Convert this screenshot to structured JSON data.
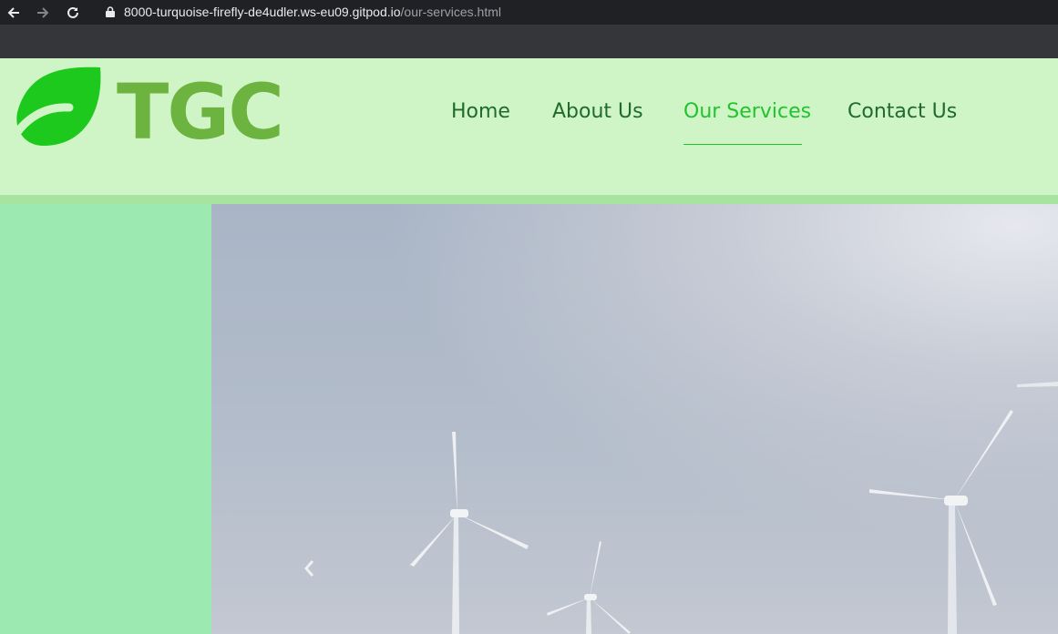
{
  "browser": {
    "url_host": "8000-turquoise-firefly-de4udler.ws-eu09.gitpod.io",
    "url_path": "/our-services.html"
  },
  "header": {
    "logo_text": "TGC",
    "nav": [
      {
        "label": "Home",
        "active": false
      },
      {
        "label": "About Us",
        "active": false
      },
      {
        "label": "Our Services",
        "active": true
      },
      {
        "label": "Contact Us",
        "active": false
      }
    ]
  },
  "colors": {
    "header_bg": "#cff5c6",
    "header_border": "#a8e4a0",
    "side_panel": "#9de9b2",
    "logo_leaf": "#1ec91e",
    "logo_text": "#6db33f",
    "nav_text": "#1f6b2a",
    "nav_active": "#22c32e"
  },
  "hero": {
    "image": "wind-turbines"
  },
  "icons": [
    "back-arrow-icon",
    "forward-arrow-icon",
    "reload-icon",
    "lock-icon",
    "leaf-logo-icon",
    "chevron-left-icon"
  ]
}
